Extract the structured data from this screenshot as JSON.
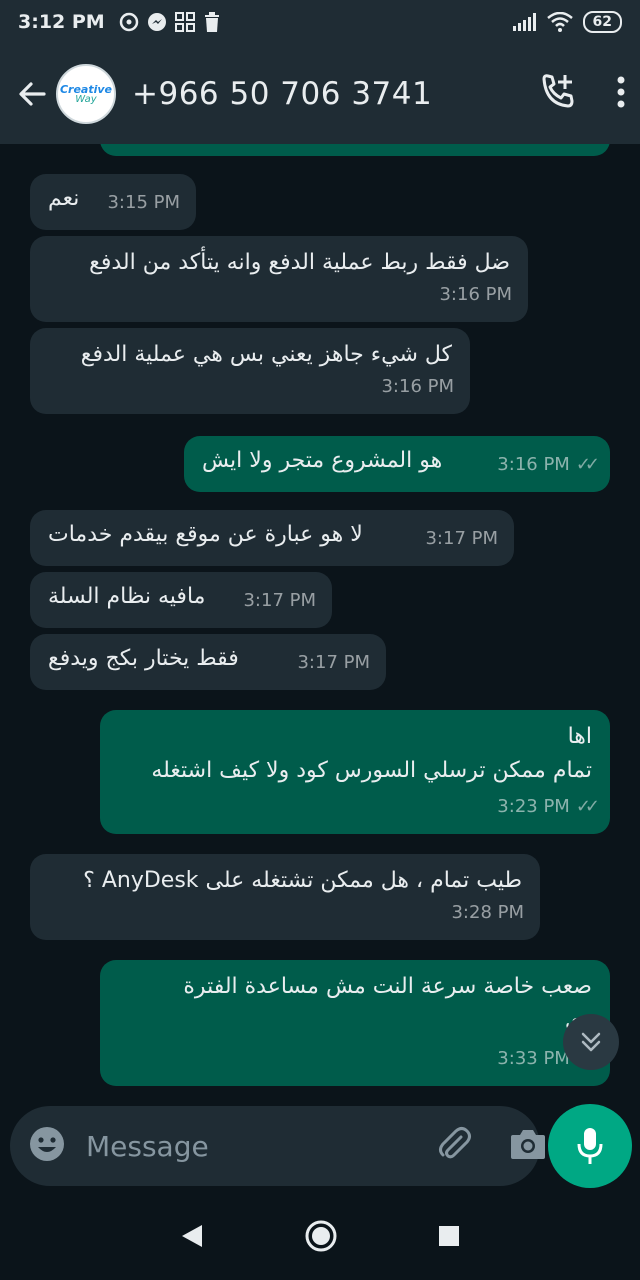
{
  "status_bar": {
    "time": "3:12 PM",
    "battery": "62"
  },
  "header": {
    "contact": "+966 50 706 3741",
    "avatar_text_1": "Creative",
    "avatar_text_2": "Way"
  },
  "messages": [
    {
      "dir": "in",
      "lines": "نعم",
      "time": "3:15 PM"
    },
    {
      "dir": "in",
      "lines": "ضل فقط ربط عملية الدفع وانه يتأكد من الدفع",
      "time": "3:16 PM"
    },
    {
      "dir": "in",
      "lines": "كل شيء جاهز يعني بس هي عملية الدفع",
      "time": "3:16 PM"
    },
    {
      "dir": "out",
      "lines": "هو المشروع متجر ولا ايش",
      "time": "3:16 PM"
    },
    {
      "dir": "in",
      "lines": "لا هو عبارة عن موقع بيقدم خدمات",
      "time": "3:17 PM"
    },
    {
      "dir": "in",
      "lines": "مافيه نظام السلة",
      "time": "3:17 PM"
    },
    {
      "dir": "in",
      "lines": "فقط يختار بكج ويدفع",
      "time": "3:17 PM"
    },
    {
      "dir": "out",
      "lines": "اها\nتمام ممكن ترسلي السورس كود ولا كيف اشتغله",
      "time": "3:23 PM"
    },
    {
      "dir": "in",
      "lines": "طيب تمام ، هل ممكن تشتغله على AnyDesk ؟",
      "time": "3:28 PM"
    },
    {
      "dir": "out",
      "lines": "صعب خاصة سرعة النت مش مساعدة الفترة\nدي",
      "time": "3:33 PM"
    }
  ],
  "input": {
    "placeholder": "Message"
  },
  "colors": {
    "accent": "#00a884",
    "outgoing": "#005c4b",
    "incoming": "#1f2c34",
    "background": "#0b141a"
  }
}
